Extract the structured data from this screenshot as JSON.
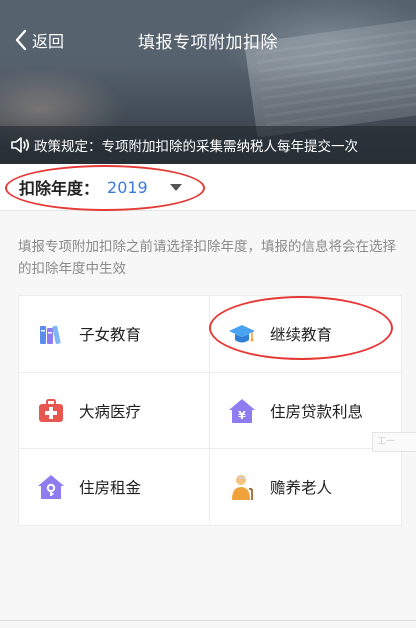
{
  "header": {
    "back_label": "返回",
    "title": "填报专项附加扣除",
    "notice": "政策规定：专项附加扣除的采集需纳税人每年提交一次"
  },
  "year_selector": {
    "label": "扣除年度：",
    "value": "2019"
  },
  "description": "填报专项附加扣除之前请选择扣除年度，填报的信息将会在选择的扣除年度中生效",
  "categories": [
    {
      "label": "子女教育",
      "icon": "books-icon"
    },
    {
      "label": "继续教育",
      "icon": "graduation-cap-icon"
    },
    {
      "label": "大病医疗",
      "icon": "medical-kit-icon"
    },
    {
      "label": "住房贷款利息",
      "icon": "house-yen-icon"
    },
    {
      "label": "住房租金",
      "icon": "house-key-icon"
    },
    {
      "label": "赡养老人",
      "icon": "elder-person-icon"
    }
  ],
  "side_tab": "工一",
  "colors": {
    "accent_blue": "#3a7bd5",
    "annotation_red": "#e53935",
    "icon_purple": "#8e7cf0",
    "icon_red": "#e8574f",
    "icon_orange": "#f0a23c"
  }
}
